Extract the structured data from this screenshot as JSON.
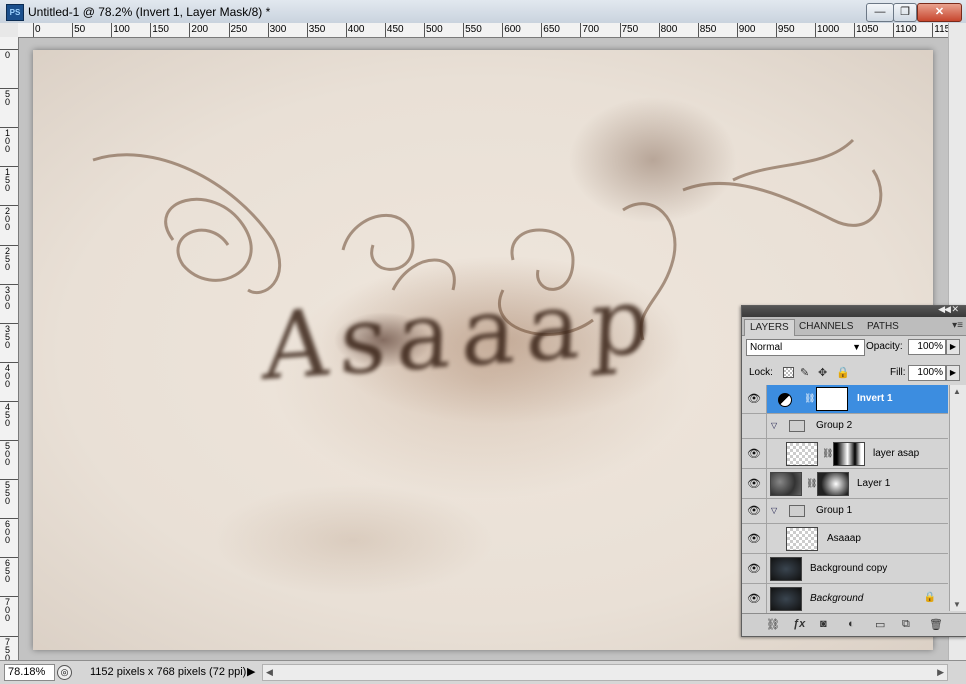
{
  "window": {
    "app_icon": "PS",
    "title": "Untitled-1 @ 78.2% (Invert 1, Layer Mask/8) *",
    "buttons": {
      "minimize": "—",
      "restore": "❐",
      "close": "✕"
    }
  },
  "ruler": {
    "top_labels": [
      "0",
      "50",
      "100",
      "150",
      "200",
      "250",
      "300",
      "350",
      "400",
      "450",
      "500",
      "550",
      "600",
      "650",
      "700",
      "750",
      "800",
      "850",
      "900",
      "950",
      "1000",
      "1050",
      "1100",
      "115"
    ],
    "left_labels": [
      "0",
      "50",
      "100",
      "150",
      "200",
      "250",
      "300",
      "350",
      "400",
      "450",
      "500",
      "550",
      "600",
      "650",
      "700",
      "750"
    ]
  },
  "artwork": {
    "text": "Asaaap"
  },
  "status": {
    "zoom": "78.18%",
    "info": "1152 pixels x 768 pixels (72 ppi)"
  },
  "layers_panel": {
    "tabs": [
      "LAYERS",
      "CHANNELS",
      "PATHS"
    ],
    "blend_mode": "Normal",
    "opacity_label": "Opacity:",
    "opacity_value": "100%",
    "lock_label": "Lock:",
    "fill_label": "Fill:",
    "fill_value": "100%",
    "layers": [
      {
        "name": "Invert 1",
        "type": "adjustment",
        "selected": true
      },
      {
        "name": "Group 2",
        "type": "group"
      },
      {
        "name": "layer asap",
        "type": "masked-layer"
      },
      {
        "name": "Layer 1",
        "type": "masked-layer"
      },
      {
        "name": "Group 1",
        "type": "group"
      },
      {
        "name": "Asaaap",
        "type": "layer"
      },
      {
        "name": "Background copy",
        "type": "layer"
      },
      {
        "name": "Background",
        "type": "background",
        "locked": true
      }
    ]
  }
}
